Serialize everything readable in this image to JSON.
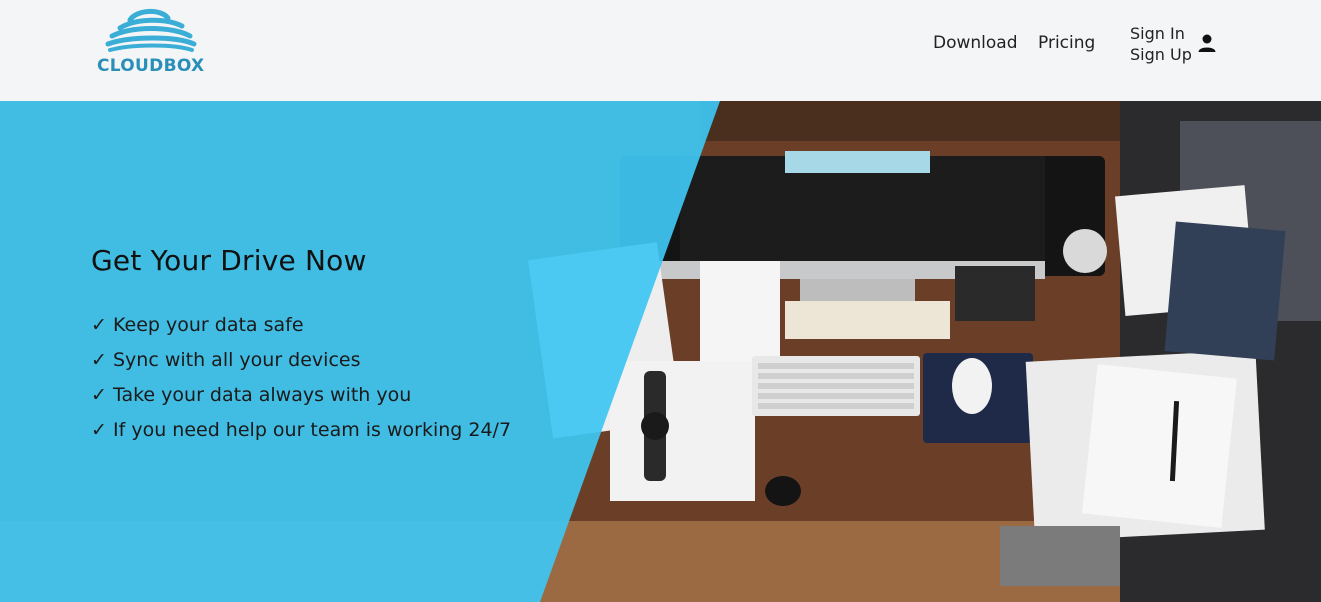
{
  "brand": {
    "name": "CLOUDBOX",
    "color": "#2a8fb8",
    "logo_icon": "cloud-waves-icon"
  },
  "nav": {
    "download": "Download",
    "pricing": "Pricing",
    "sign_in": "Sign In",
    "sign_up": "Sign Up",
    "user_icon": "user-icon"
  },
  "hero": {
    "title": "Get Your Drive Now",
    "check_icon": "checkmark-icon",
    "check_glyph": "✓",
    "features": [
      "Keep your data safe",
      "Sync with all your devices",
      "Take your data always with you",
      "If you need help our team is working 24/7"
    ],
    "overlay_color": "#3ec6f2"
  }
}
